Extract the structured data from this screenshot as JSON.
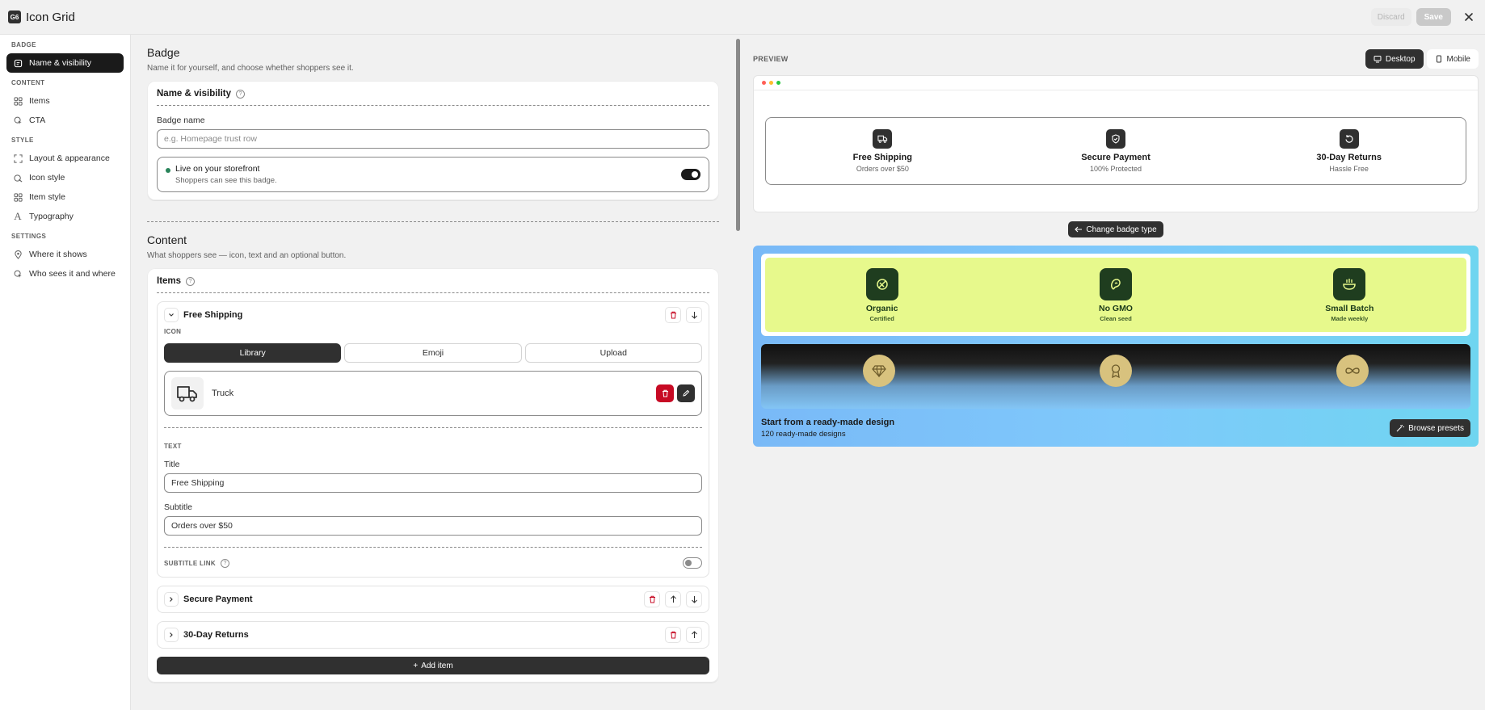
{
  "app": {
    "logo": "G6",
    "title": "Icon Grid",
    "discard_label": "Discard",
    "save_label": "Save"
  },
  "sidebar": {
    "sections": [
      {
        "label": "BADGE",
        "items": [
          {
            "label": "Name & visibility",
            "icon": "badge-icon",
            "active": true
          }
        ]
      },
      {
        "label": "CONTENT",
        "items": [
          {
            "label": "Items",
            "icon": "grid-icon"
          },
          {
            "label": "CTA",
            "icon": "cursor-click-icon"
          }
        ]
      },
      {
        "label": "STYLE",
        "items": [
          {
            "label": "Layout & appearance",
            "icon": "layout-icon"
          },
          {
            "label": "Icon style",
            "icon": "brush-icon"
          },
          {
            "label": "Item style",
            "icon": "grid-icon"
          },
          {
            "label": "Typography",
            "icon": "text-icon"
          }
        ]
      },
      {
        "label": "SETTINGS",
        "items": [
          {
            "label": "Where it shows",
            "icon": "location-pin-icon"
          },
          {
            "label": "Who sees it and where",
            "icon": "target-icon"
          }
        ]
      }
    ]
  },
  "badge_section": {
    "title": "Badge",
    "subtitle": "Name it for yourself, and choose whether shoppers see it.",
    "card_title": "Name & visibility",
    "name_label": "Badge name",
    "name_placeholder": "e.g. Homepage trust row",
    "live_title": "Live on your storefront",
    "live_sub": "Shoppers can see this badge."
  },
  "content_section": {
    "title": "Content",
    "subtitle": "What shoppers see — icon, text and an optional button.",
    "items_title": "Items",
    "expanded_item": {
      "name": "Free Shipping",
      "icon_label": "ICON",
      "tabs": [
        "Library",
        "Emoji",
        "Upload"
      ],
      "icon_name": "Truck",
      "text_label": "TEXT",
      "title_label": "Title",
      "title_value": "Free Shipping",
      "subtitle_label": "Subtitle",
      "subtitle_value": "Orders over $50",
      "subtitle_link_label": "SUBTITLE LINK"
    },
    "collapsed_items": [
      "Secure Payment",
      "30-Day Returns"
    ],
    "add_item_label": "Add item"
  },
  "preview": {
    "label": "PREVIEW",
    "desktop_label": "Desktop",
    "mobile_label": "Mobile",
    "badges": [
      {
        "title": "Free Shipping",
        "subtitle": "Orders over $50",
        "icon": "truck-icon"
      },
      {
        "title": "Secure Payment",
        "subtitle": "100% Protected",
        "icon": "shield-check-icon"
      },
      {
        "title": "30-Day Returns",
        "subtitle": "Hassle Free",
        "icon": "rotate-icon"
      }
    ],
    "change_label": "Change badge type",
    "preset_items": [
      {
        "title": "Organic",
        "subtitle": "Certified",
        "icon": "leaf-icon"
      },
      {
        "title": "No GMO",
        "subtitle": "Clean seed",
        "icon": "bean-icon"
      },
      {
        "title": "Small Batch",
        "subtitle": "Made weekly",
        "icon": "bowl-icon"
      }
    ],
    "preset_icons2": [
      "diamond-icon",
      "award-icon",
      "infinity-icon"
    ],
    "presets_title": "Start from a ready-made design",
    "presets_sub": "120 ready-made designs",
    "browse_label": "Browse presets"
  },
  "colors": {
    "accent": "#303030",
    "live_dot": "#29845a",
    "danger": "#c70a24",
    "preset_bg": "#7fc9fb",
    "preset_lime": "#e7f98c"
  }
}
